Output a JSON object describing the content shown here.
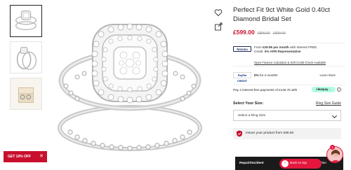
{
  "breadcrumb": "...",
  "product": {
    "title": "Perfect Fit 9ct White Gold 0.40ct Diamond Bridal Set",
    "price": "£599.00",
    "was_price_1": "£899.00",
    "was_price_2": "£999.00"
  },
  "finance": {
    "brand": "Novuna",
    "line1_pre": "From ",
    "line1_bold": "£29.95 per month",
    "line1_post": " with Interest FREE",
    "line2_pre": "Credit. ",
    "line2_bold": "0% APR Representative",
    "link": "Open Finance Calculator & Soft Credit Check Available"
  },
  "paypal": {
    "badge": "PayPal CREDIT",
    "text_pre": "",
    "text_bold": "0%",
    "text_post": " for 4 months",
    "learn_more": "Learn More"
  },
  "clearpay": {
    "text": "Pay 4 interest-free payments of £149.75 with",
    "badge": "clearpay→",
    "info": "i"
  },
  "size": {
    "label": "Select Your Size:",
    "guide": "Ring Size Guide",
    "placeholder": "Select a Ring Size"
  },
  "insurance": {
    "text": "Insure your product from £85.50"
  },
  "repair": {
    "label": "Repair/Incident",
    "right": "a Plan"
  },
  "back_to_top": {
    "label": "Back to top",
    "arrow": "↑"
  },
  "offer": {
    "label": "GET 10% OFF",
    "close": "✕"
  },
  "chat_badge": "1",
  "colors": {
    "accent": "#c8102e",
    "clearpay": "#b2fce4",
    "dark_bar": "#1a1a1a"
  }
}
